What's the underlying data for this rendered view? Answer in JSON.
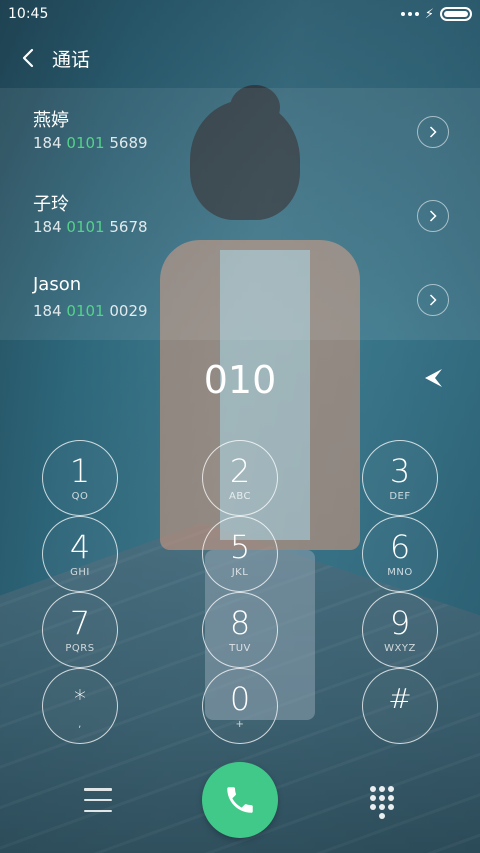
{
  "status_bar": {
    "time": "10:45"
  },
  "header": {
    "title": "通话"
  },
  "contacts": [
    {
      "name": "燕婷",
      "number_prefix": "184 ",
      "number_match": "0101",
      "number_suffix": " 5689"
    },
    {
      "name": "子玲",
      "number_prefix": "184 ",
      "number_match": "0101",
      "number_suffix": " 5678"
    },
    {
      "name": "Jason",
      "number_prefix": "184 ",
      "number_match": "0101",
      "number_suffix": " 0029"
    }
  ],
  "dial_input": {
    "value": "010"
  },
  "keypad": [
    {
      "digit": "1",
      "letters": "QO"
    },
    {
      "digit": "2",
      "letters": "ABC"
    },
    {
      "digit": "3",
      "letters": "DEF"
    },
    {
      "digit": "4",
      "letters": "GHI"
    },
    {
      "digit": "5",
      "letters": "JKL"
    },
    {
      "digit": "6",
      "letters": "MNO"
    },
    {
      "digit": "7",
      "letters": "PQRS"
    },
    {
      "digit": "8",
      "letters": "TUV"
    },
    {
      "digit": "9",
      "letters": "WXYZ"
    },
    {
      "digit": "*",
      "letters": ","
    },
    {
      "digit": "0",
      "letters": "+"
    },
    {
      "digit": "#",
      "letters": ""
    }
  ],
  "colors": {
    "call_button": "#41c98a",
    "match_highlight": "#55d28a"
  },
  "icons": {
    "back": "chevron-left-icon",
    "contact_detail": "chevron-right-icon",
    "delete": "backspace-arrow-icon",
    "menu": "hamburger-menu-icon",
    "call": "phone-icon",
    "dialpad": "dialpad-icon"
  }
}
